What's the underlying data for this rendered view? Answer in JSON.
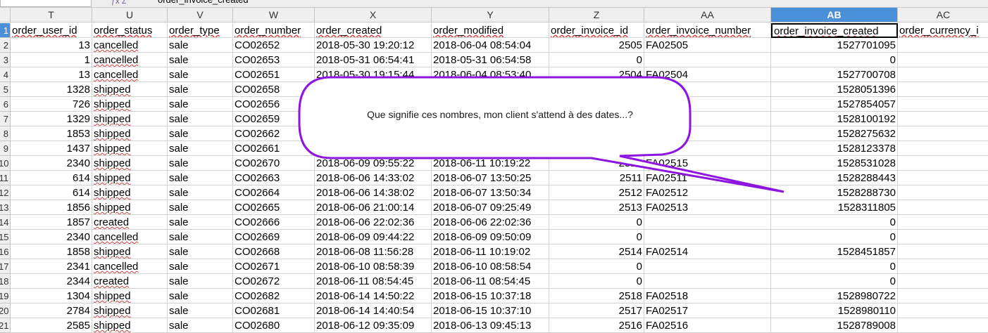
{
  "toolbar": {
    "formula_text": "order_invoice_created"
  },
  "columns": [
    {
      "letter": "T",
      "active": false
    },
    {
      "letter": "U",
      "active": false
    },
    {
      "letter": "V",
      "active": false
    },
    {
      "letter": "W",
      "active": false
    },
    {
      "letter": "X",
      "active": false
    },
    {
      "letter": "Y",
      "active": false
    },
    {
      "letter": "Z",
      "active": false
    },
    {
      "letter": "AA",
      "active": false
    },
    {
      "letter": "AB",
      "active": true
    },
    {
      "letter": "AC",
      "active": false
    }
  ],
  "row_numbers": [
    "1",
    "2",
    "3",
    "4",
    "5",
    "6",
    "7",
    "8",
    "9",
    "10",
    "11",
    "12",
    "13",
    "14",
    "15",
    "16",
    "17",
    "18",
    "19",
    "20",
    "21"
  ],
  "headers": [
    "order_user_id",
    "order_status",
    "order_type",
    "order_number",
    "order_created",
    "order_modified",
    "order_invoice_id",
    "order_invoice_number",
    "order_invoice_created",
    "order_currency_i"
  ],
  "rows": [
    [
      "13",
      "cancelled",
      "sale",
      "CO02652",
      "2018-05-30 19:20:12",
      "2018-06-04 08:54:04",
      "2505",
      "FA02505",
      "1527701095"
    ],
    [
      "1",
      "cancelled",
      "sale",
      "CO02653",
      "2018-05-31 06:54:41",
      "2018-05-31 06:54:58",
      "0",
      "",
      "0"
    ],
    [
      "13",
      "cancelled",
      "sale",
      "CO02651",
      "2018-05-30 19:15:44",
      "2018-06-04 08:53:40",
      "2504",
      "FA02504",
      "1527700708"
    ],
    [
      "1328",
      "shipped",
      "sale",
      "CO02658",
      "",
      "",
      "",
      "7",
      "1528051396"
    ],
    [
      "726",
      "shipped",
      "sale",
      "CO02656",
      "",
      "",
      "",
      "6",
      "1527854057"
    ],
    [
      "1329",
      "shipped",
      "sale",
      "CO02659",
      "",
      "",
      "",
      "8",
      "1528100192"
    ],
    [
      "1853",
      "shipped",
      "sale",
      "CO02662",
      "",
      "",
      "",
      "0",
      "1528275632"
    ],
    [
      "1437",
      "shipped",
      "sale",
      "CO02661",
      "",
      "",
      "",
      "09",
      "1528123378"
    ],
    [
      "2340",
      "shipped",
      "sale",
      "CO02670",
      "2018-06-09 09:55:22",
      "2018-06-11 10:19:22",
      "2515",
      "FA02515",
      "1528531028"
    ],
    [
      "614",
      "shipped",
      "sale",
      "CO02663",
      "2018-06-06 14:33:02",
      "2018-06-07 13:50:25",
      "2511",
      "FA02511",
      "1528288443"
    ],
    [
      "614",
      "shipped",
      "sale",
      "CO02664",
      "2018-06-06 14:38:02",
      "2018-06-07 13:50:34",
      "2512",
      "FA02512",
      "1528288730"
    ],
    [
      "1856",
      "shipped",
      "sale",
      "CO02665",
      "2018-06-06 21:00:14",
      "2018-06-07 09:25:49",
      "2513",
      "FA02513",
      "1528311805"
    ],
    [
      "1857",
      "created",
      "sale",
      "CO02666",
      "2018-06-06 22:02:36",
      "2018-06-06 22:02:36",
      "0",
      "",
      "0"
    ],
    [
      "2340",
      "cancelled",
      "sale",
      "CO02669",
      "2018-06-09 09:44:22",
      "2018-06-09 09:50:09",
      "0",
      "",
      "0"
    ],
    [
      "1858",
      "shipped",
      "sale",
      "CO02668",
      "2018-06-08 11:56:28",
      "2018-06-11 10:19:02",
      "2514",
      "FA02514",
      "1528451857"
    ],
    [
      "2341",
      "cancelled",
      "sale",
      "CO02671",
      "2018-06-10 08:58:39",
      "2018-06-10 08:58:54",
      "0",
      "",
      "0"
    ],
    [
      "2344",
      "created",
      "sale",
      "CO02672",
      "2018-06-11 08:54:45",
      "2018-06-11 08:54:45",
      "0",
      "",
      "0"
    ],
    [
      "1304",
      "shipped",
      "sale",
      "CO02682",
      "2018-06-14 14:50:22",
      "2018-06-15 10:37:18",
      "2518",
      "FA02518",
      "1528980722"
    ],
    [
      "2784",
      "shipped",
      "sale",
      "CO02681",
      "2018-06-14 14:40:54",
      "2018-06-15 10:37:10",
      "2517",
      "FA02517",
      "1528980110"
    ],
    [
      "2585",
      "shipped",
      "sale",
      "CO02680",
      "2018-06-12 09:35:09",
      "2018-06-13 09:45:13",
      "2516",
      "FA02516",
      "1528789008"
    ]
  ],
  "callout": {
    "text": "Que signifie ces nombres, mon client s'attend à des dates...?",
    "stroke_color": "#8e14e0"
  },
  "colors": {
    "active_header": "#4a90d9",
    "spell_underline": "#d04040"
  }
}
